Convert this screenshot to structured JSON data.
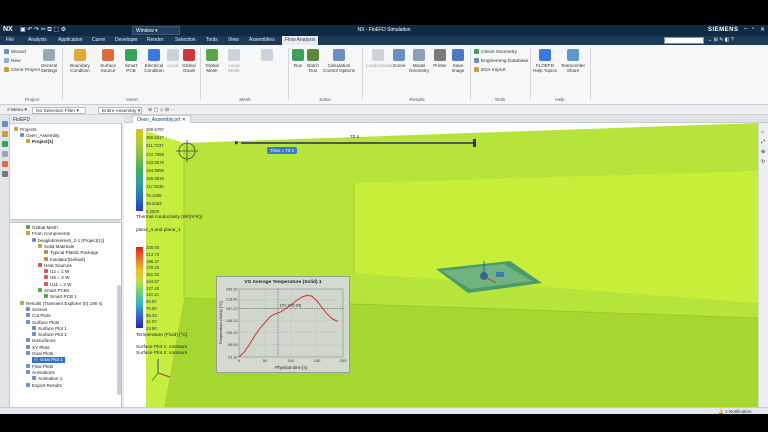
{
  "app": {
    "logo": "NX",
    "title": "NX - FloEFD Simulation",
    "window_menu": "Window",
    "brand": "SIEMENS"
  },
  "menubar": {
    "items": [
      "File",
      "Analysis",
      "Application",
      "Curve",
      "Developer",
      "Render",
      "Selection",
      "Tools",
      "View",
      "Assemblies",
      "Flow Analysis"
    ],
    "active": "Flow Analysis"
  },
  "ribbon": {
    "project": {
      "wizard": "Wizard",
      "new": "New",
      "clone": "Clone Project",
      "general": "General Settings",
      "group": "Project"
    },
    "insert": {
      "boundary": "Boundary Condition",
      "surface_source": "Surface Source",
      "smart_pcb": "Smart PCB",
      "electrical": "Electrical Condition",
      "local": "Local",
      "goals": "Global Goals",
      "group": "Insert"
    },
    "mesh": {
      "global": "Global Mesh",
      "local_mesh": "Local Mesh",
      "group": "Mesh"
    },
    "solve": {
      "run": "Run",
      "batch": "Batch Run",
      "calc": "Calculation Control Options",
      "group": "Solve"
    },
    "results": {
      "load": "Load/Unload",
      "scene": "Scene",
      "model": "Model Geometry",
      "printer": "Printer",
      "save": "Save Image",
      "group": "Results"
    },
    "tools": {
      "check": "Check Geometry",
      "engdb": "Engineering Database",
      "eda": "EDA Import",
      "group": "Tools"
    },
    "help": {
      "floefd": "FLOEFD Help Topics",
      "teamcenter": "Teamcenter Share",
      "group": "Help"
    }
  },
  "toolbar": {
    "menu": "Menu",
    "filter": "No Selection Filter",
    "assembly": "Entire Assembly"
  },
  "navigator": {
    "header": "FloEFD",
    "tree": [
      {
        "label": "Projects",
        "lvl": 0,
        "c": "#c9a03a"
      },
      {
        "label": "Oven_Assembly",
        "lvl": 1,
        "c": "#6a8fc7"
      },
      {
        "label": "Project(1)",
        "lvl": 2,
        "c": "#c9a03a",
        "bold": true
      },
      {
        "label": "Global Mesh",
        "lvl": 2,
        "c": "#58a64a"
      },
      {
        "label": "From Components",
        "lvl": 2,
        "c": "#c9a03a"
      },
      {
        "label": "beaglebonerev6_2-1 [Project(1)]",
        "lvl": 3,
        "c": "#6a8fc7"
      },
      {
        "label": "Solid Materials",
        "lvl": 4,
        "c": "#c9a03a"
      },
      {
        "label": "Typical Plastic Package",
        "lvl": 5,
        "c": "#b58c4a"
      },
      {
        "label": "Insulator(Default)",
        "lvl": 5,
        "c": "#b58c4a"
      },
      {
        "label": "Heat Sources",
        "lvl": 4,
        "c": "#d9534f"
      },
      {
        "label": "U2 = 1 W",
        "lvl": 5,
        "c": "#d9534f"
      },
      {
        "label": "U5 = 3 W",
        "lvl": 5,
        "c": "#d9534f"
      },
      {
        "label": "U11 = 2 W",
        "lvl": 5,
        "c": "#d9534f"
      },
      {
        "label": "Smart PCBs",
        "lvl": 4,
        "c": "#58a64a"
      },
      {
        "label": "Smart PCB 1",
        "lvl": 5,
        "c": "#58a64a"
      },
      {
        "label": "Results (Transient Explorer (0) 190 s)",
        "lvl": 1,
        "c": "#c9a03a"
      },
      {
        "label": "Scenes",
        "lvl": 2,
        "c": "#6a8fc7"
      },
      {
        "label": "Cut Plots",
        "lvl": 2,
        "c": "#6a8fc7"
      },
      {
        "label": "Surface Plots",
        "lvl": 2,
        "c": "#6a8fc7"
      },
      {
        "label": "Surface Plot 1",
        "lvl": 3,
        "c": "#6a8fc7"
      },
      {
        "label": "Surface Plot 2",
        "lvl": 3,
        "c": "#6a8fc7"
      },
      {
        "label": "Isosurfaces",
        "lvl": 2,
        "c": "#6a8fc7"
      },
      {
        "label": "XY Plots",
        "lvl": 2,
        "c": "#6a8fc7"
      },
      {
        "label": "Goal Plots",
        "lvl": 2,
        "c": "#6a8fc7"
      },
      {
        "label": "Goal Plot 1",
        "lvl": 3,
        "c": "#6a8fc7",
        "sel": true
      },
      {
        "label": "Flow Plots",
        "lvl": 2,
        "c": "#6a8fc7"
      },
      {
        "label": "Animations",
        "lvl": 2,
        "c": "#6a8fc7"
      },
      {
        "label": "Animation 1",
        "lvl": 3,
        "c": "#6a8fc7"
      },
      {
        "label": "Export Results",
        "lvl": 2,
        "c": "#6a8fc7"
      }
    ]
  },
  "graphics": {
    "tab": "Oven_Assembly.prt",
    "time_marker": "70 s",
    "time_badge": "Time = 70 s",
    "legend1": {
      "values": [
        "389.5797",
        "350.6617",
        "311.7237",
        "272.7558",
        "233.8676",
        "194.9096",
        "155.9916",
        "117.0635",
        "78.1355",
        "39.2283",
        "0.2000"
      ],
      "title": "Thermal conductivity [W/(m*K)]",
      "planes": "plane_4 and plane_1"
    },
    "legend2": {
      "values": [
        "230.00",
        "213.73",
        "196.47",
        "179.20",
        "161.93",
        "144.67",
        "127.40",
        "110.13",
        "92.87",
        "75.60",
        "58.33",
        "41.07",
        "23.80"
      ],
      "title": "Temperature (Fluid) [°C]",
      "notes": [
        "Surface Plot 1: contours",
        "Surface Plot 2: contours"
      ]
    },
    "colors": {
      "field": "#c9f03a",
      "field_dark": "#9fd12a",
      "plot_bg": "#d4dad2"
    }
  },
  "chart_data": {
    "type": "line",
    "title": "VG Average Temperature (Solid) 1",
    "xlabel": "Physical time [s]",
    "ylabel": "Temperature (Solid) [°C]",
    "xlim": [
      0,
      200
    ],
    "ylim": [
      23.16,
      254.15
    ],
    "xticks": [
      0,
      50,
      100,
      150,
      200
    ],
    "yticks": [
      "23.16",
      "65.53",
      "106.10",
      "146.23",
      "187.22",
      "218.80",
      "254.15"
    ],
    "series": [
      {
        "values_x": [
          0,
          10,
          20,
          30,
          40,
          50,
          60,
          70,
          80,
          90,
          100,
          110,
          120,
          130,
          140,
          150,
          160,
          170,
          180,
          190
        ],
        "values_y": [
          23.16,
          40,
          65,
          95,
          120,
          140,
          160,
          170,
          176,
          188,
          200,
          214,
          226,
          232,
          230,
          214,
          190,
          168,
          152,
          144
        ]
      }
    ],
    "marker": {
      "x": 75,
      "label": "[70; 215.83]"
    },
    "hline": 187.22
  },
  "status": {
    "notification": "1 Notification"
  }
}
